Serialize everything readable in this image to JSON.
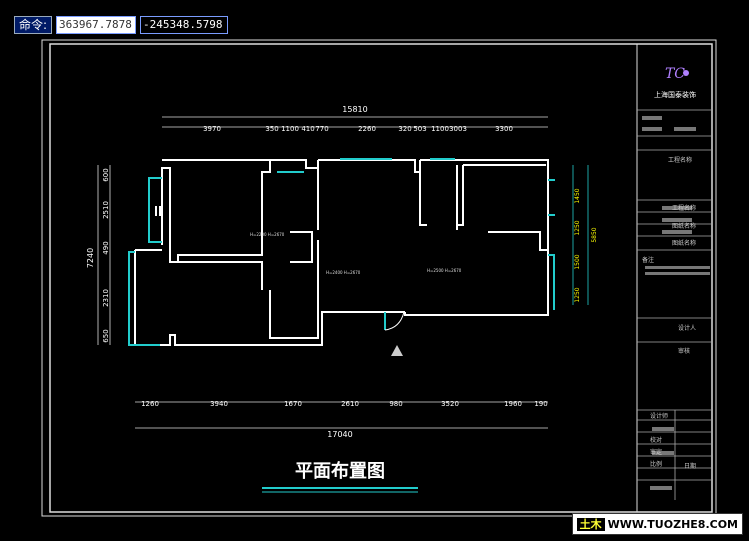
{
  "command": {
    "label": "命令:",
    "x_value": "363967.7878",
    "y_value": "-245348.5798"
  },
  "title": "平面布置图",
  "company": {
    "name": "上海国泰装饰"
  },
  "top_dims": {
    "total": "15810",
    "segments": [
      "3970",
      "350",
      "1100",
      "410",
      "770",
      "2260",
      "320",
      "503",
      "1100",
      "3003",
      "3300"
    ]
  },
  "bottom_dims": {
    "total": "17040",
    "segments": [
      "1260",
      "3940",
      "1670",
      "2610",
      "980",
      "3520",
      "1960",
      "190"
    ]
  },
  "left_dims": {
    "total": "7240",
    "segments": [
      "600",
      "2510",
      "490",
      "2310",
      "650"
    ]
  },
  "right_dims": {
    "total": "5850",
    "segments": [
      "1450",
      "1250",
      "1500",
      "1250"
    ]
  },
  "room_notes": [
    "H=2200\nH=2670",
    "H=2400\nH=2670",
    "H=2500\nH=2670"
  ],
  "title_block_rows": [
    "工程名称",
    "工程名称",
    "图纸名称",
    "图纸名称",
    "备注",
    "设计人",
    "审核",
    "设计师",
    "校对",
    "审定",
    "比例",
    "日期"
  ],
  "watermark": {
    "prefix": "土木",
    "text": "WWW.TUOZHE8.COM"
  }
}
